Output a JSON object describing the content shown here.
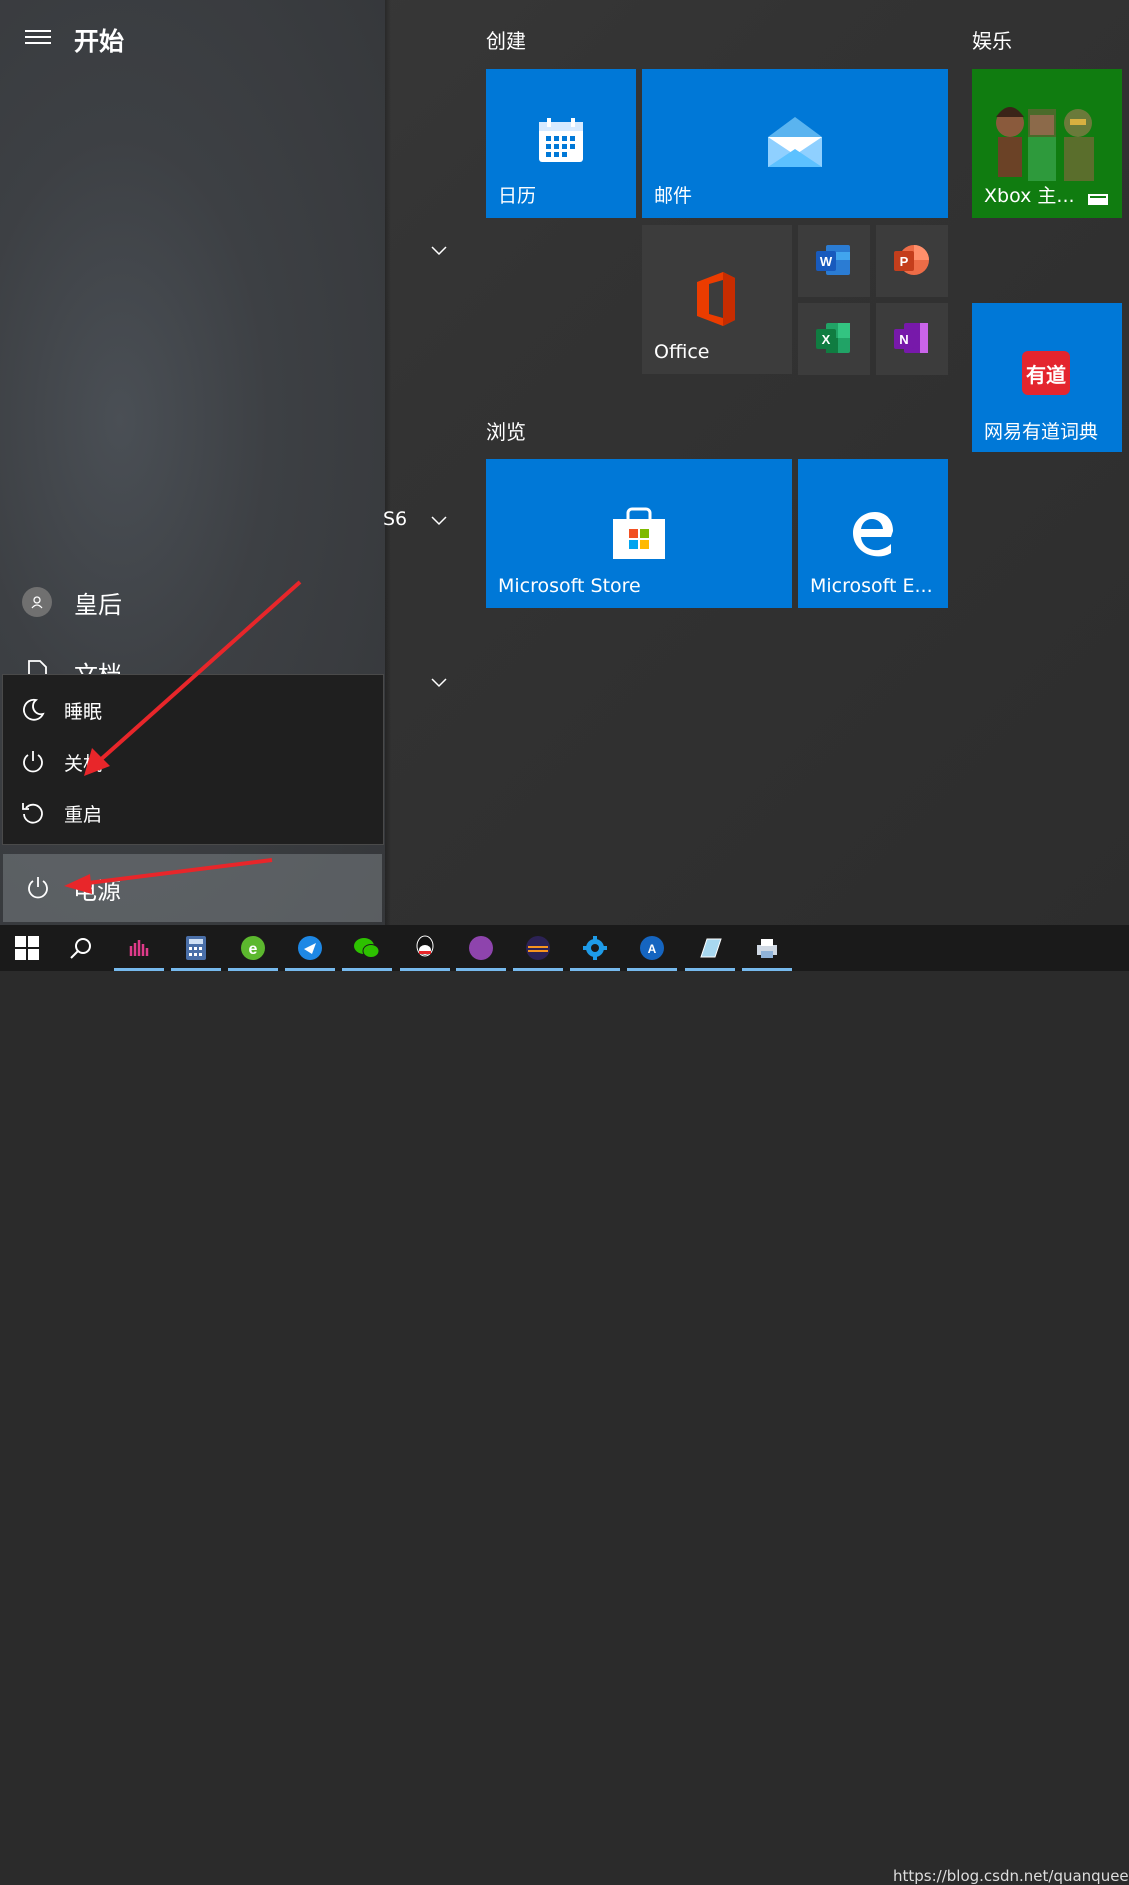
{
  "start": {
    "title": "开始"
  },
  "left_rail": {
    "user_name": "皇后",
    "documents_label": "文档",
    "app_fragment": "S6"
  },
  "power_menu": {
    "items": [
      {
        "label": "睡眠",
        "icon": "moon-icon"
      },
      {
        "label": "关机",
        "icon": "power-icon"
      },
      {
        "label": "重启",
        "icon": "restart-icon"
      }
    ],
    "power_label": "电源"
  },
  "groups": {
    "create": "创建",
    "browse": "浏览",
    "entertainment": "娱乐"
  },
  "tiles": {
    "calendar": "日历",
    "mail": "邮件",
    "office": "Office",
    "xbox": "Xbox 主...",
    "youdao": "网易有道词典",
    "youdao_logo": "有道",
    "store": "Microsoft Store",
    "edge": "Microsoft E..."
  },
  "taskbar": {
    "watermark": "https://blog.csdn.net/quanqueen",
    "icons": [
      "windows-logo-icon",
      "search-icon",
      "app-icon",
      "calculator-icon",
      "browser-icon",
      "feishu-icon",
      "wechat-icon",
      "qq-icon",
      "matt-icon",
      "eclipse-icon",
      "settings-icon",
      "aide-icon",
      "notepad-icon",
      "printer-icon"
    ]
  },
  "colors": {
    "tile_blue": "#0078d7",
    "arrow_red": "#e8262a"
  }
}
